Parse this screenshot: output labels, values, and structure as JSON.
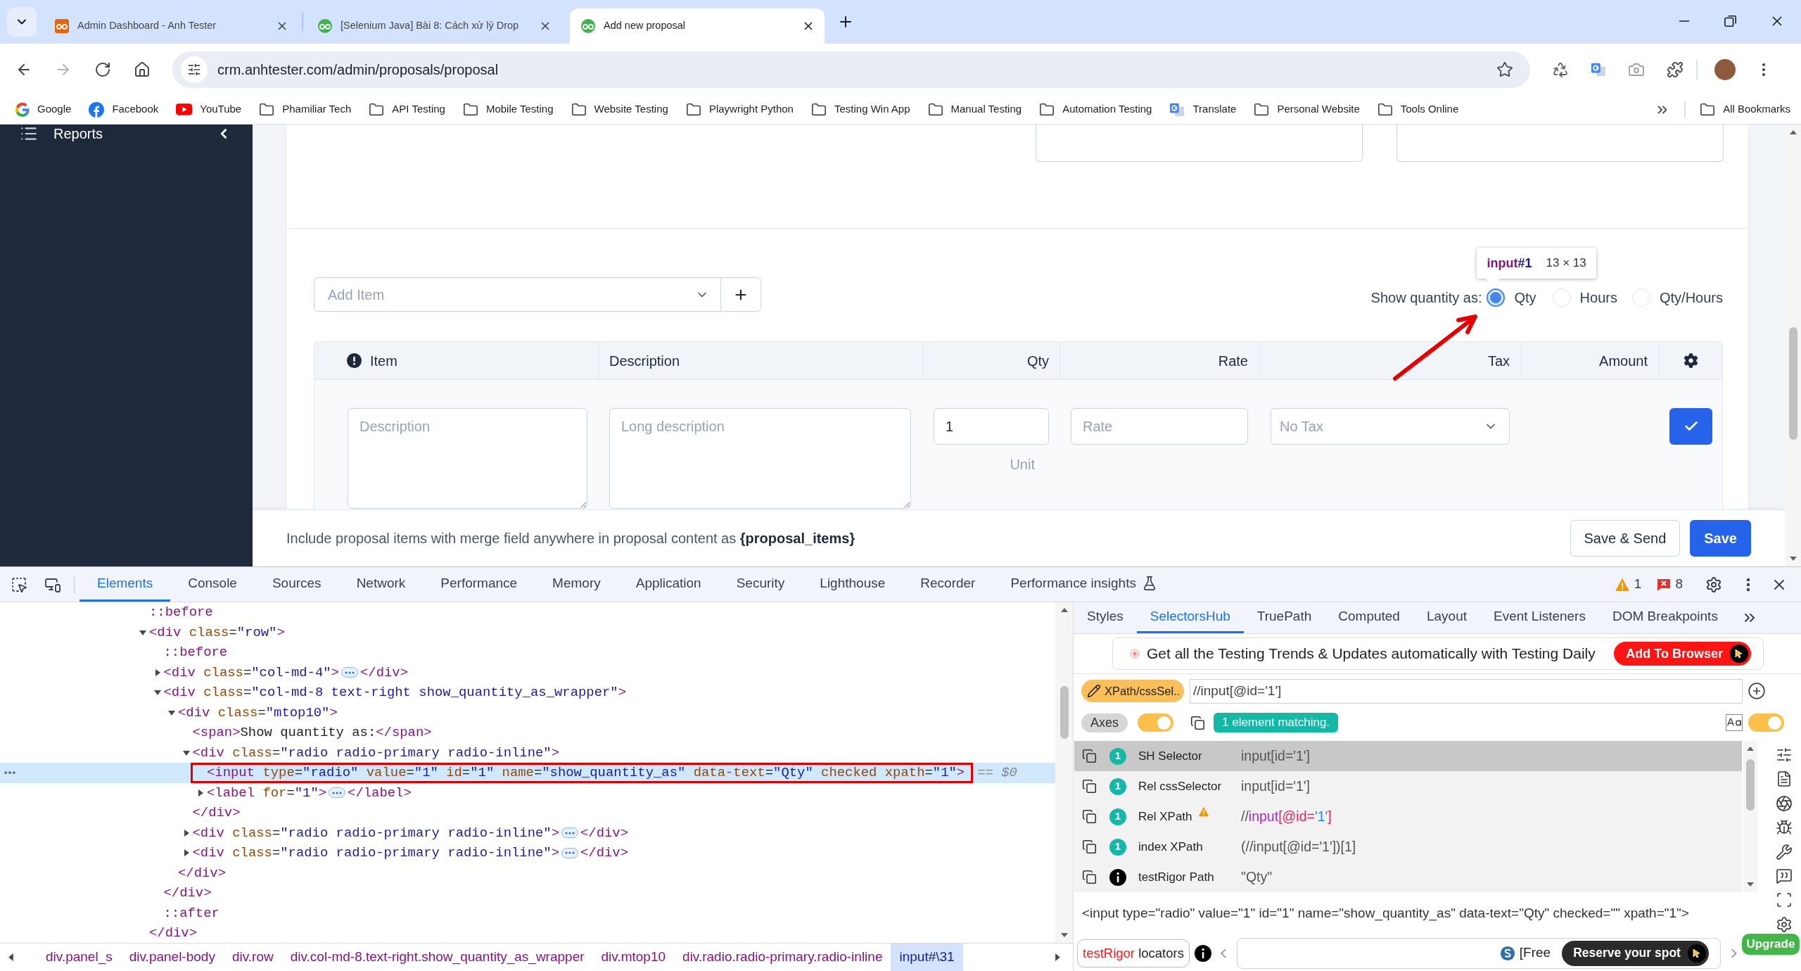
{
  "browser": {
    "tabs": [
      {
        "title": "Admin Dashboard - Anh Tester",
        "selected": false,
        "kind": "square",
        "color": "#e8630a"
      },
      {
        "title": "[Selenium Java] Bài 8: Cách xử lý Drop",
        "selected": false,
        "kind": "round",
        "color": "#3cb44b"
      },
      {
        "title": "Add new proposal",
        "selected": true,
        "kind": "round",
        "color": "#3cb44b"
      }
    ],
    "nav_buttons": [
      {
        "kind": "back",
        "disabled": false
      },
      {
        "kind": "forward",
        "disabled": true
      },
      {
        "kind": "reload",
        "disabled": false
      },
      {
        "kind": "home",
        "disabled": false
      }
    ],
    "url": "crm.anhtester.com/admin/proposals/proposal",
    "bookmarks": [
      {
        "label": "Google",
        "kind": "google"
      },
      {
        "label": "Facebook",
        "kind": "facebook"
      },
      {
        "label": "YouTube",
        "kind": "youtube"
      },
      {
        "label": "Phamiliar Tech",
        "kind": "folder"
      },
      {
        "label": "API Testing",
        "kind": "folder"
      },
      {
        "label": "Mobile Testing",
        "kind": "folder"
      },
      {
        "label": "Website Testing",
        "kind": "folder"
      },
      {
        "label": "Playwright Python",
        "kind": "folder"
      },
      {
        "label": "Testing Win App",
        "kind": "folder"
      },
      {
        "label": "Manual Testing",
        "kind": "folder"
      },
      {
        "label": "Automation Testing",
        "kind": "folder"
      },
      {
        "label": "Translate",
        "kind": "translate"
      },
      {
        "label": "Personal Website",
        "kind": "folder"
      },
      {
        "label": "Tools Online",
        "kind": "folder"
      }
    ],
    "all_bookmarks": "All Bookmarks"
  },
  "sidebar": {
    "items": [
      {
        "label": "Reports"
      }
    ]
  },
  "proposal": {
    "add_item": {
      "placeholder": "Add Item"
    },
    "show_quantity": {
      "label": "Show quantity as:",
      "options": [
        {
          "label": "Qty",
          "selected": true
        },
        {
          "label": "Hours",
          "selected": false
        },
        {
          "label": "Qty/Hours",
          "selected": false
        }
      ]
    },
    "tooltip": {
      "tag": "input",
      "id": "#1",
      "size": "13 × 13"
    },
    "table": {
      "columns": [
        {
          "label": "Item",
          "kind": "flagged"
        },
        {
          "label": "Description",
          "kind": "text"
        },
        {
          "label": "Qty",
          "kind": "text"
        },
        {
          "label": "Rate",
          "kind": "text"
        },
        {
          "label": "Tax",
          "kind": "text"
        },
        {
          "label": "Amount",
          "kind": "text"
        },
        {
          "kind": "gear"
        }
      ],
      "new_row": {
        "description": {
          "placeholder": "Description"
        },
        "long_description": {
          "placeholder": "Long description"
        },
        "qty": {
          "value": "1"
        },
        "unit": {
          "placeholder": "Unit"
        },
        "rate": {
          "placeholder": "Rate"
        },
        "tax": {
          "placeholder": "No Tax"
        }
      }
    },
    "footer": {
      "text": "Include proposal items with merge field anywhere in proposal content as **{proposal_items}**",
      "buttons": [
        {
          "label": "Save & Send",
          "kind": "secondary"
        },
        {
          "label": "Save",
          "kind": "primary"
        }
      ]
    }
  },
  "devtools": {
    "tabs": [
      {
        "label": "Elements",
        "selected": true,
        "kind": "plain"
      },
      {
        "label": "Console",
        "selected": false,
        "kind": "plain"
      },
      {
        "label": "Sources",
        "selected": false,
        "kind": "plain"
      },
      {
        "label": "Network",
        "selected": false,
        "kind": "plain"
      },
      {
        "label": "Performance",
        "selected": false,
        "kind": "plain"
      },
      {
        "label": "Memory",
        "selected": false,
        "kind": "plain"
      },
      {
        "label": "Application",
        "selected": false,
        "kind": "plain"
      },
      {
        "label": "Security",
        "selected": false,
        "kind": "plain"
      },
      {
        "label": "Lighthouse",
        "selected": false,
        "kind": "plain"
      },
      {
        "label": "Recorder",
        "selected": false,
        "kind": "plain"
      },
      {
        "label": "Performance insights",
        "selected": false,
        "kind": "experiment"
      }
    ],
    "issues": [
      {
        "kind": "warning",
        "count": "1"
      },
      {
        "kind": "error",
        "count": "8"
      }
    ],
    "dom_tree": [
      {
        "kind": "pseudo",
        "text": "::before",
        "selected": false
      },
      {
        "kind": "element",
        "open": "<div class=\"row\">",
        "close": "</div>",
        "expanded": true,
        "selected": false,
        "children": [
          {
            "kind": "pseudo",
            "text": "::before",
            "selected": false
          },
          {
            "kind": "element",
            "open": "<div class=\"col-md-4\">",
            "close": "</div>",
            "expanded": false,
            "selected": false
          },
          {
            "kind": "element",
            "open": "<div class=\"col-md-8 text-right show_quantity_as_wrapper\">",
            "close": "</div>",
            "expanded": true,
            "selected": false,
            "children": [
              {
                "kind": "element",
                "open": "<div class=\"mtop10\">",
                "close": "</div>",
                "expanded": true,
                "selected": false,
                "children": [
                  {
                    "kind": "leaf",
                    "text": "<span>Show quantity as:</span>",
                    "selected": false
                  },
                  {
                    "kind": "element",
                    "open": "<div class=\"radio radio-primary radio-inline\">",
                    "close": "</div>",
                    "expanded": true,
                    "selected": false,
                    "children": [
                      {
                        "kind": "leaf",
                        "text": "<input type=\"radio\" value=\"1\" id=\"1\" name=\"show_quantity_as\" data-text=\"Qty\" checked xpath=\"1\">",
                        "selected": true,
                        "suffix": "== $0"
                      },
                      {
                        "kind": "element",
                        "open": "<label for=\"1\">",
                        "close": "</label>",
                        "expanded": false,
                        "selected": false
                      }
                    ]
                  },
                  {
                    "kind": "element",
                    "open": "<div class=\"radio radio-primary radio-inline\">",
                    "close": "</div>",
                    "expanded": false,
                    "selected": false
                  },
                  {
                    "kind": "element",
                    "open": "<div class=\"radio radio-primary radio-inline\">",
                    "close": "</div>",
                    "expanded": false,
                    "selected": false
                  }
                ]
              }
            ]
          },
          {
            "kind": "pseudo",
            "text": "::after",
            "selected": false
          }
        ]
      }
    ],
    "breadcrumbs": [
      {
        "label": "div.panel_s",
        "selected": false
      },
      {
        "label": "div.panel-body",
        "selected": false
      },
      {
        "label": "div.row",
        "selected": false
      },
      {
        "label": "div.col-md-8.text-right.show_quantity_as_wrapper",
        "selected": false
      },
      {
        "label": "div.mtop10",
        "selected": false
      },
      {
        "label": "div.radio.radio-primary.radio-inline",
        "selected": false
      },
      {
        "label": "input#\\31",
        "selected": true
      }
    ],
    "side": {
      "tabs": [
        {
          "label": "Styles",
          "selected": false
        },
        {
          "label": "SelectorsHub",
          "selected": true
        },
        {
          "label": "TruePath",
          "selected": false
        },
        {
          "label": "Computed",
          "selected": false
        },
        {
          "label": "Layout",
          "selected": false
        },
        {
          "label": "Event Listeners",
          "selected": false
        },
        {
          "label": "DOM Breakpoints",
          "selected": false
        }
      ],
      "banner": {
        "text": "Get all the Testing Trends & Updates automatically with Testing Daily",
        "button": "Add To Browser"
      },
      "mode_button": "XPath/cssSel..",
      "query": "//input[@id='1']",
      "axes": {
        "label": "Axes",
        "on": true
      },
      "match_status": "1 element matching.",
      "case_toggle": {
        "on": true
      },
      "rows": [
        {
          "label": "SH Selector",
          "kind": "count",
          "badge": "1",
          "warning": false,
          "selected": true,
          "value": [
            {
              "text": "input[id='1']",
              "kind": "plain"
            }
          ]
        },
        {
          "label": "Rel cssSelector",
          "kind": "count",
          "badge": "1",
          "warning": false,
          "selected": false,
          "value": [
            {
              "text": "input[id='1']",
              "kind": "plain"
            }
          ]
        },
        {
          "label": "Rel XPath",
          "kind": "count",
          "badge": "1",
          "warning": true,
          "selected": false,
          "value": [
            {
              "text": "//",
              "kind": "plain"
            },
            {
              "text": "input",
              "kind": "tag"
            },
            {
              "text": "[@id=",
              "kind": "attr"
            },
            {
              "text": "'1'",
              "kind": "value"
            },
            {
              "text": "]",
              "kind": "attr"
            }
          ]
        },
        {
          "label": "index XPath",
          "kind": "count",
          "badge": "1",
          "warning": false,
          "selected": false,
          "value": [
            {
              "text": "(//input[@id='1'])[1]",
              "kind": "plain"
            }
          ]
        },
        {
          "label": "testRigor Path",
          "kind": "info",
          "warning": false,
          "selected": false,
          "value": [
            {
              "text": "\"Qty\"",
              "kind": "plain"
            }
          ]
        }
      ],
      "outer_html": "<input type=\"radio\" value=\"1\" id=\"1\" name=\"show_quantity_as\" data-text=\"Qty\" checked=\"\" xpath=\"1\">",
      "locators_button": {
        "accent": "testRigor",
        "label": "locators"
      },
      "promo": {
        "text": "[Free",
        "button": "Reserve your spot"
      },
      "upgrade": "Upgrade"
    }
  }
}
